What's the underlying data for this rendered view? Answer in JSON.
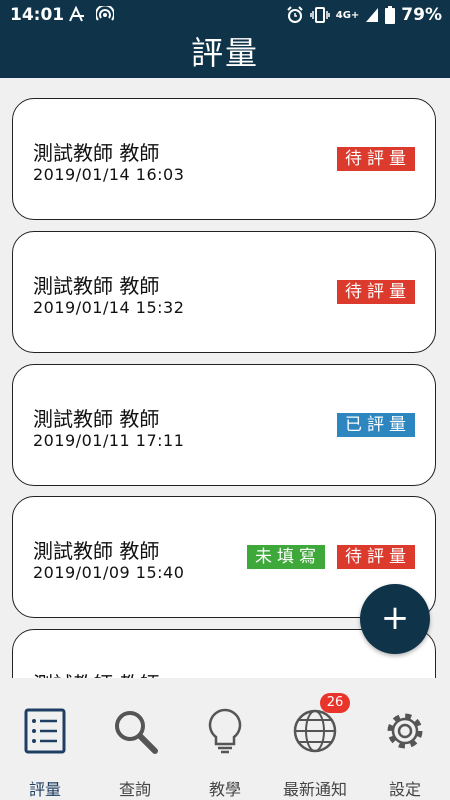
{
  "status_bar": {
    "time": "14:01",
    "network": "4G+",
    "battery": "79%"
  },
  "header": {
    "title": "評量"
  },
  "records": [
    {
      "name": "測試教師 教師",
      "datetime": "2019/01/14 16:03",
      "badges": [
        {
          "text": "待評量",
          "type": "pending"
        }
      ]
    },
    {
      "name": "測試教師 教師",
      "datetime": "2019/01/14 15:32",
      "badges": [
        {
          "text": "待評量",
          "type": "pending"
        }
      ]
    },
    {
      "name": "測試教師 教師",
      "datetime": "2019/01/11 17:11",
      "badges": [
        {
          "text": "已評量",
          "type": "done"
        }
      ]
    },
    {
      "name": "測試教師 教師",
      "datetime": "2019/01/09 15:40",
      "badges": [
        {
          "text": "未填寫",
          "type": "unfilled"
        },
        {
          "text": "待評量",
          "type": "pending"
        }
      ]
    },
    {
      "name": "測試教師 教師",
      "datetime": "",
      "badges": []
    }
  ],
  "fab": {
    "label": "+"
  },
  "nav": [
    {
      "label": "評量",
      "icon": "evaluation-list-icon",
      "active": true
    },
    {
      "label": "查詢",
      "icon": "search-icon"
    },
    {
      "label": "教學",
      "icon": "lightbulb-icon"
    },
    {
      "label": "最新通知",
      "icon": "globe-icon",
      "badge": "26"
    },
    {
      "label": "設定",
      "icon": "gear-icon"
    }
  ],
  "colors": {
    "primary": "#0f3449",
    "pending": "#db3a2c",
    "done": "#2e86c1",
    "unfilled": "#3ea83a",
    "active_nav": "#1f3e63",
    "notif": "#e8342b"
  }
}
